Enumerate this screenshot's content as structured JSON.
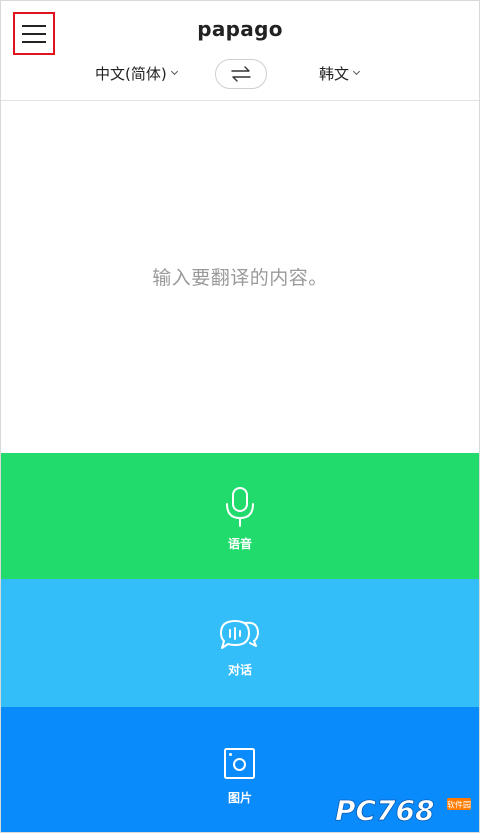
{
  "header": {
    "logo": "papago",
    "menu_icon": "hamburger-menu-icon"
  },
  "languages": {
    "source": "中文(简体)",
    "target": "韩文",
    "swap_icon": "swap-arrows-icon"
  },
  "input": {
    "placeholder": "输入要翻译的内容。"
  },
  "modes": [
    {
      "label": "语音",
      "icon": "microphone-icon",
      "color": "#22db6d"
    },
    {
      "label": "对话",
      "icon": "chat-bubbles-icon",
      "color": "#33bdf9"
    },
    {
      "label": "图片",
      "icon": "camera-icon",
      "color": "#0a8bfb"
    }
  ],
  "watermark": {
    "text": "PC768",
    "small_text": "软件园"
  }
}
